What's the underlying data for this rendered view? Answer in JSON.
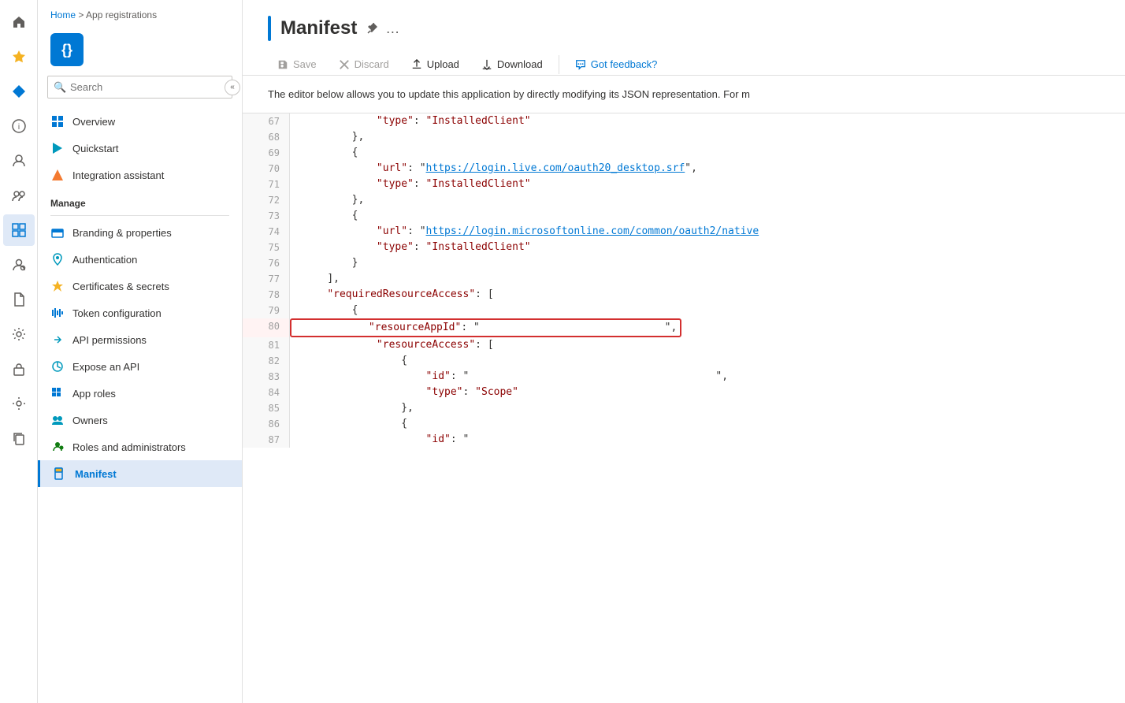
{
  "iconBar": {
    "items": [
      {
        "name": "home-icon",
        "icon": "⌂",
        "active": false
      },
      {
        "name": "favorites-icon",
        "icon": "★",
        "active": false
      },
      {
        "name": "diamond-icon",
        "icon": "◆",
        "active": false
      },
      {
        "name": "info-icon",
        "icon": "ⓘ",
        "active": false
      },
      {
        "name": "person-icon",
        "icon": "👤",
        "active": false
      },
      {
        "name": "group-icon",
        "icon": "👥",
        "active": false
      },
      {
        "name": "grid-icon",
        "icon": "⊞",
        "active": true
      },
      {
        "name": "settings-person-icon",
        "icon": "⚙",
        "active": false
      },
      {
        "name": "document-icon",
        "icon": "📄",
        "active": false
      },
      {
        "name": "gear-icon",
        "icon": "⚙",
        "active": false
      },
      {
        "name": "lock-icon",
        "icon": "🔒",
        "active": false
      },
      {
        "name": "settings-icon",
        "icon": "⚙",
        "active": false
      },
      {
        "name": "copy-icon",
        "icon": "⧉",
        "active": false
      }
    ]
  },
  "breadcrumb": {
    "home": "Home",
    "separator": " > ",
    "current": "App registrations"
  },
  "appIcon": "{}",
  "search": {
    "placeholder": "Search"
  },
  "nav": {
    "topItems": [
      {
        "label": "Overview",
        "icon": "grid"
      },
      {
        "label": "Quickstart",
        "icon": "bolt"
      },
      {
        "label": "Integration assistant",
        "icon": "rocket"
      }
    ],
    "manageLabel": "Manage",
    "manageItems": [
      {
        "label": "Branding & properties",
        "icon": "tag"
      },
      {
        "label": "Authentication",
        "icon": "auth"
      },
      {
        "label": "Certificates & secrets",
        "icon": "cert"
      },
      {
        "label": "Token configuration",
        "icon": "token"
      },
      {
        "label": "API permissions",
        "icon": "api"
      },
      {
        "label": "Expose an API",
        "icon": "expose"
      },
      {
        "label": "App roles",
        "icon": "approles"
      },
      {
        "label": "Owners",
        "icon": "owners"
      },
      {
        "label": "Roles and administrators",
        "icon": "roles"
      },
      {
        "label": "Manifest",
        "icon": "manifest",
        "active": true
      }
    ]
  },
  "page": {
    "title": "Manifest",
    "pinIcon": "📌",
    "moreIcon": "…",
    "description": "The editor below allows you to update this application by directly modifying its JSON representation. For m"
  },
  "toolbar": {
    "saveLabel": "Save",
    "discardLabel": "Discard",
    "uploadLabel": "Upload",
    "downloadLabel": "Download",
    "feedbackLabel": "Got feedback?"
  },
  "codeLines": [
    {
      "num": "67",
      "content": "            \"type\": \"InstalledClient\"",
      "highlight": false
    },
    {
      "num": "68",
      "content": "        },",
      "highlight": false
    },
    {
      "num": "69",
      "content": "        {",
      "highlight": false
    },
    {
      "num": "70",
      "content": "            \"url\": \"https://login.live.com/oauth20_desktop.srf\",",
      "highlight": false,
      "hasUrl": true,
      "urlText": "https://login.live.com/oauth20_desktop.srf"
    },
    {
      "num": "71",
      "content": "            \"type\": \"InstalledClient\"",
      "highlight": false
    },
    {
      "num": "72",
      "content": "        },",
      "highlight": false
    },
    {
      "num": "73",
      "content": "        {",
      "highlight": false
    },
    {
      "num": "74",
      "content": "            \"url\": \"https://login.microsoftonline.com/common/oauth2/native",
      "highlight": false,
      "hasUrl": true,
      "urlText": "https://login.microsoftonline.com/common/oauth2/native"
    },
    {
      "num": "75",
      "content": "            \"type\": \"InstalledClient\"",
      "highlight": false
    },
    {
      "num": "76",
      "content": "        }",
      "highlight": false
    },
    {
      "num": "77",
      "content": "    ],",
      "highlight": false
    },
    {
      "num": "78",
      "content": "    \"requiredResourceAccess\": [",
      "highlight": false
    },
    {
      "num": "79",
      "content": "        {",
      "highlight": false
    },
    {
      "num": "80",
      "content": "            \"resourceAppId\": \"                              \",",
      "highlight": true
    },
    {
      "num": "81",
      "content": "            \"resourceAccess\": [",
      "highlight": false
    },
    {
      "num": "82",
      "content": "                {",
      "highlight": false
    },
    {
      "num": "83",
      "content": "                    \"id\": \"                                        \",",
      "highlight": false
    },
    {
      "num": "84",
      "content": "                    \"type\": \"Scope\"",
      "highlight": false
    },
    {
      "num": "85",
      "content": "                },",
      "highlight": false
    },
    {
      "num": "86",
      "content": "                {",
      "highlight": false
    },
    {
      "num": "87",
      "content": "                    \"id\": \"",
      "highlight": false
    }
  ]
}
